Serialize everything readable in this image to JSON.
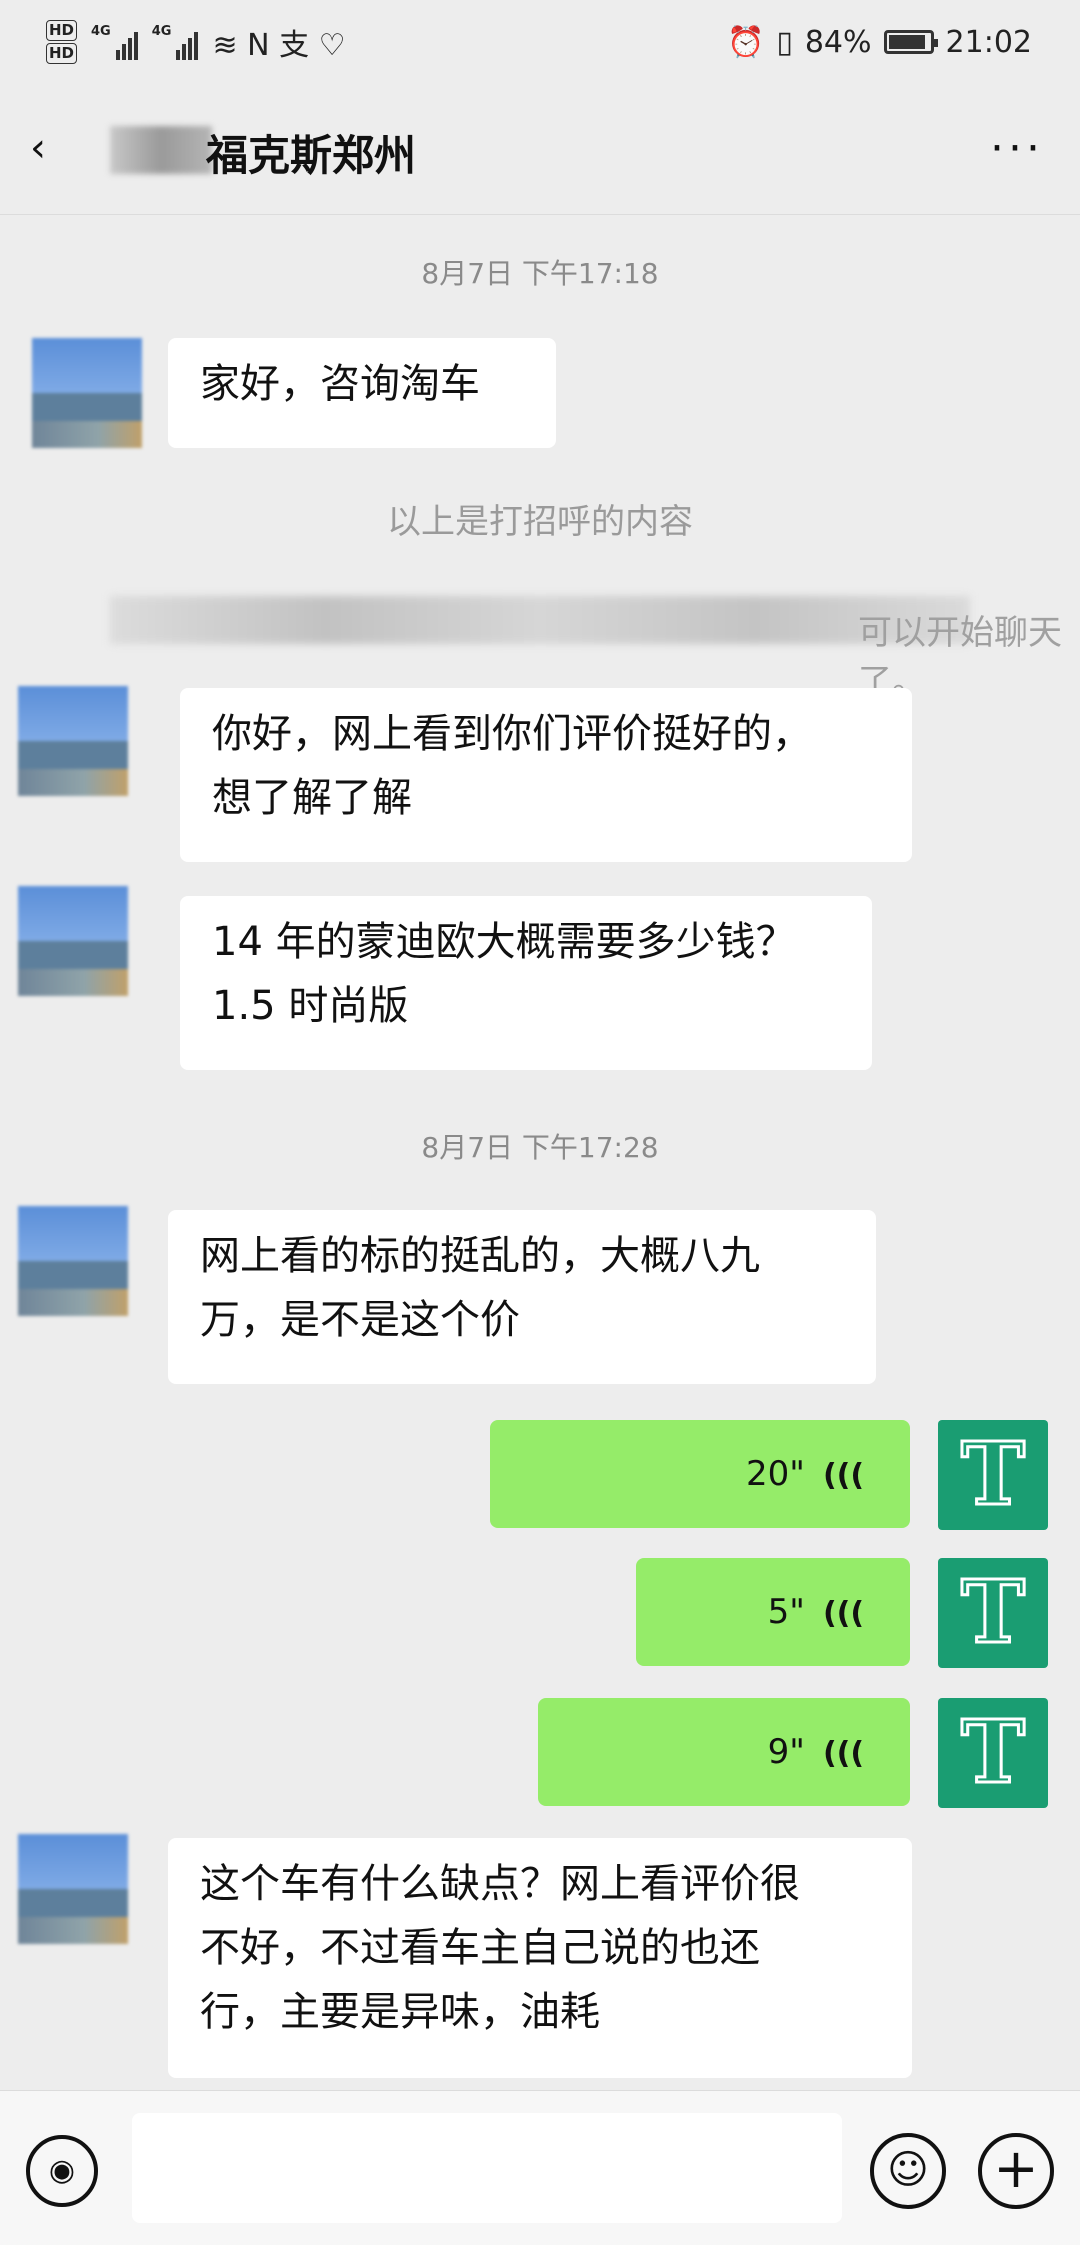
{
  "status_bar": {
    "hd1": "HD",
    "hd2": "HD",
    "net1": "4G",
    "net2": "4G",
    "extra_icons": "≋ N 支 ♡",
    "alarm_icon": "alarm-icon",
    "vibrate_icon": "vibrate-icon",
    "battery_percent": "84%",
    "battery_level": 0.84,
    "time": "21:02"
  },
  "header": {
    "title": "福克斯郑州",
    "back_icon": "back-arrow-icon",
    "more_icon": "more-icon"
  },
  "timestamps": [
    "8月7日 下午17:18",
    "8月7日 下午17:28"
  ],
  "system_messages": {
    "greeting_note": "以上是打招呼的内容",
    "start_chat_tail": "可以开始聊天了。"
  },
  "messages": [
    {
      "from": "other",
      "text": "家好，咨询淘车"
    },
    {
      "from": "other",
      "text": "你好，网上看到你们评价挺好的，\n想了解了解"
    },
    {
      "from": "other",
      "text": "14 年的蒙迪欧大概需要多少钱？\n1.5 时尚版"
    },
    {
      "from": "other",
      "text": "网上看的标的挺乱的，大概八九\n万，是不是这个价"
    },
    {
      "from": "me",
      "type": "voice",
      "duration": "20\""
    },
    {
      "from": "me",
      "type": "voice",
      "duration": "5\""
    },
    {
      "from": "me",
      "type": "voice",
      "duration": "9\""
    },
    {
      "from": "other",
      "text": "这个车有什么缺点？网上看评价很\n不好，不过看车主自己说的也还\n行，主要是异味，油耗"
    }
  ],
  "my_avatar_letter": "T",
  "input_bar": {
    "voice_icon": "voice-input-icon",
    "emoji_icon": "emoji-icon",
    "plus_icon": "plus-icon"
  }
}
